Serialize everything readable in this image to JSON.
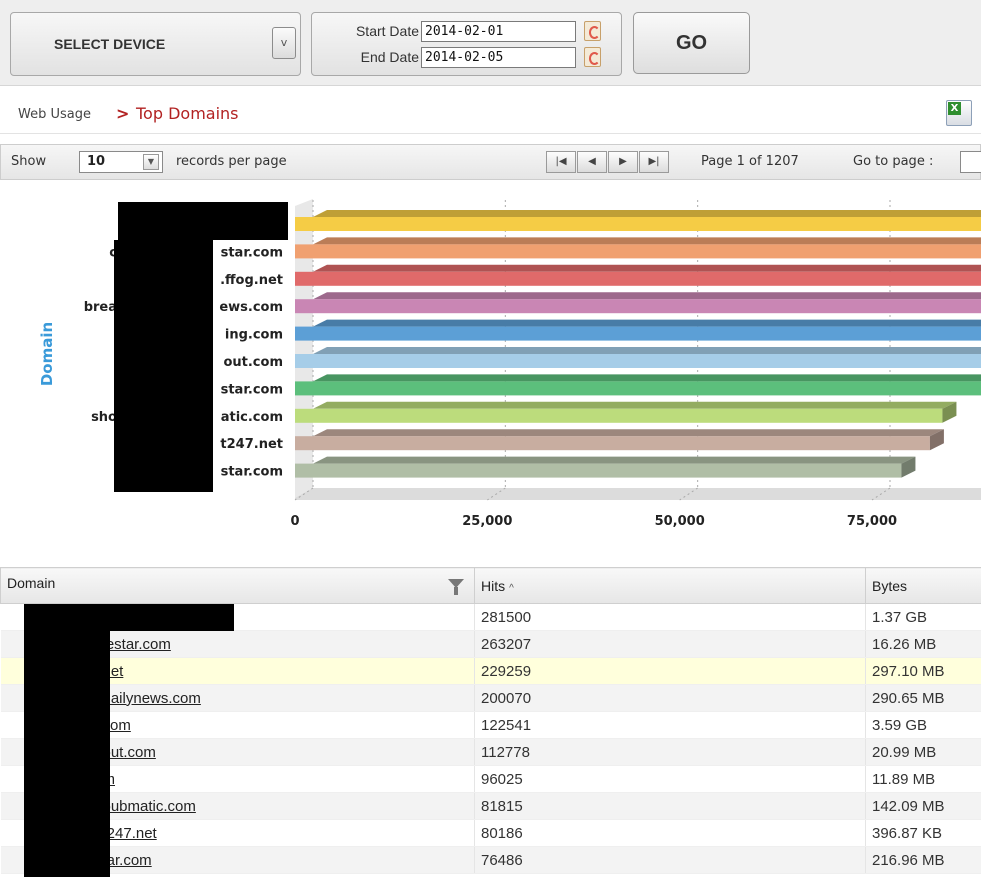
{
  "toolbar": {
    "device_label": "SELECT DEVICE",
    "device_arrow": "v",
    "start_date_label": "Start Date",
    "start_date_value": "2014-02-01",
    "end_date_label": "End Date",
    "end_date_value": "2014-02-05",
    "go_label": "GO"
  },
  "breadcrumb": {
    "parent": "Web Usage",
    "separator": ">",
    "current": "Top Domains"
  },
  "pager": {
    "show_label": "Show",
    "page_size": "10",
    "per_page_label": "records per page",
    "page_info": "Page 1 of 1207",
    "goto_label": "Go to page :",
    "nav_icons": [
      "first-page-icon",
      "prev-page-icon",
      "next-page-icon",
      "last-page-icon"
    ]
  },
  "chart_data": {
    "type": "bar",
    "orientation": "horizontal",
    "ylabel": "Domain",
    "xlabel": "",
    "x_ticks": [
      "0",
      "25,000",
      "50,000",
      "75,000"
    ],
    "xlim": [
      0,
      90000
    ],
    "grid": true,
    "categories": [
      "",
      "star.com",
      ".ffog.net",
      "ews.com",
      "ing.com",
      "out.com",
      "star.com",
      "atic.com",
      "t247.net",
      "star.com"
    ],
    "category_prefixes": [
      "",
      "c",
      "",
      "brea",
      "",
      "",
      "",
      "sho",
      "",
      ""
    ],
    "values": [
      281500,
      263207,
      229259,
      200070,
      122541,
      112778,
      96025,
      81815,
      80186,
      76486
    ],
    "colors": [
      "#f5cc45",
      "#f0a070",
      "#e06a6a",
      "#c986b4",
      "#5c9fd6",
      "#a6cde8",
      "#5cbf7c",
      "#bcdc7c",
      "#c8ada0",
      "#b0bea6"
    ]
  },
  "table": {
    "headers": {
      "domain": "Domain",
      "hits": "Hits",
      "hits_sort": "^",
      "bytes": "Bytes"
    },
    "rows": [
      {
        "domain": "",
        "hits": "281500",
        "bytes": "1.37 GB"
      },
      {
        "domain": "lestar.com",
        "hits": "263207",
        "bytes": "16.26 MB"
      },
      {
        "domain": "net",
        "hits": "229259",
        "bytes": "297.10 MB"
      },
      {
        "domain": "dailynews.com",
        "hits": "200070",
        "bytes": "290.65 MB"
      },
      {
        "domain": "com",
        "hits": "122541",
        "bytes": "3.59 GB"
      },
      {
        "domain": "out.com",
        "hits": "112778",
        "bytes": "20.99 MB"
      },
      {
        "domain": "m",
        "hits": "96025",
        "bytes": "11.89 MB"
      },
      {
        "domain": "pubmatic.com",
        "hits": "81815",
        "bytes": "142.09 MB"
      },
      {
        "domain": "t247.net",
        "hits": "80186",
        "bytes": "396.87 KB"
      },
      {
        "domain": "tar.com",
        "hits": "76486",
        "bytes": "216.96 MB"
      }
    ]
  }
}
